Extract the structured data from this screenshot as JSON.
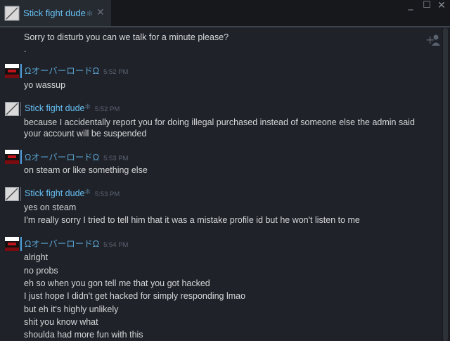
{
  "window": {
    "tab_title": "Stick fight dude",
    "close_symbol": "✕",
    "minimize_symbol": "_",
    "maximize_symbol": "☐",
    "window_close_symbol": "✕"
  },
  "colors": {
    "background": "#1f2229",
    "titlebar": "#16181c",
    "friend_name": "#67c1f5",
    "self_name": "#5aa3cf",
    "message_text": "#d6d7d8",
    "timestamp": "#5b6270"
  },
  "icons": {
    "add_friend": "add-friend-icon",
    "avatar_friend": "outlined-square-avatar",
    "avatar_self": "red-black-avatar"
  },
  "messages": {
    "first_block": {
      "lines": [
        "Sorry to disturb you can we talk for a minute please?",
        "."
      ]
    },
    "g1": {
      "name": "ΩオーバーロードΩ",
      "time": "5:52 PM",
      "lines": [
        "yo wassup"
      ]
    },
    "g2": {
      "name": "Stick fight dude",
      "time": "5:52 PM",
      "lines": [
        "because I accidentally report you for doing illegal purchased instead of someone else the admin said",
        "your account will be suspended"
      ]
    },
    "g3": {
      "name": "ΩオーバーロードΩ",
      "time": "5:53 PM",
      "lines": [
        "on steam or like something else"
      ]
    },
    "g4": {
      "name": "Stick fight dude",
      "time": "5:53 PM",
      "lines": [
        "yes on steam",
        "I'm really sorry I tried to tell him that it was a mistake profile id but he won't listen to me"
      ]
    },
    "g5": {
      "name": "ΩオーバーロードΩ",
      "time": "5:54 PM",
      "lines": [
        "alright",
        "no probs",
        "eh so when you gon tell me that you got hacked",
        "I just hope I didn't get hacked for simply responding lmao",
        "but eh it's highly unlikely",
        "shit you know what",
        "shoulda had more fun with this"
      ]
    }
  }
}
